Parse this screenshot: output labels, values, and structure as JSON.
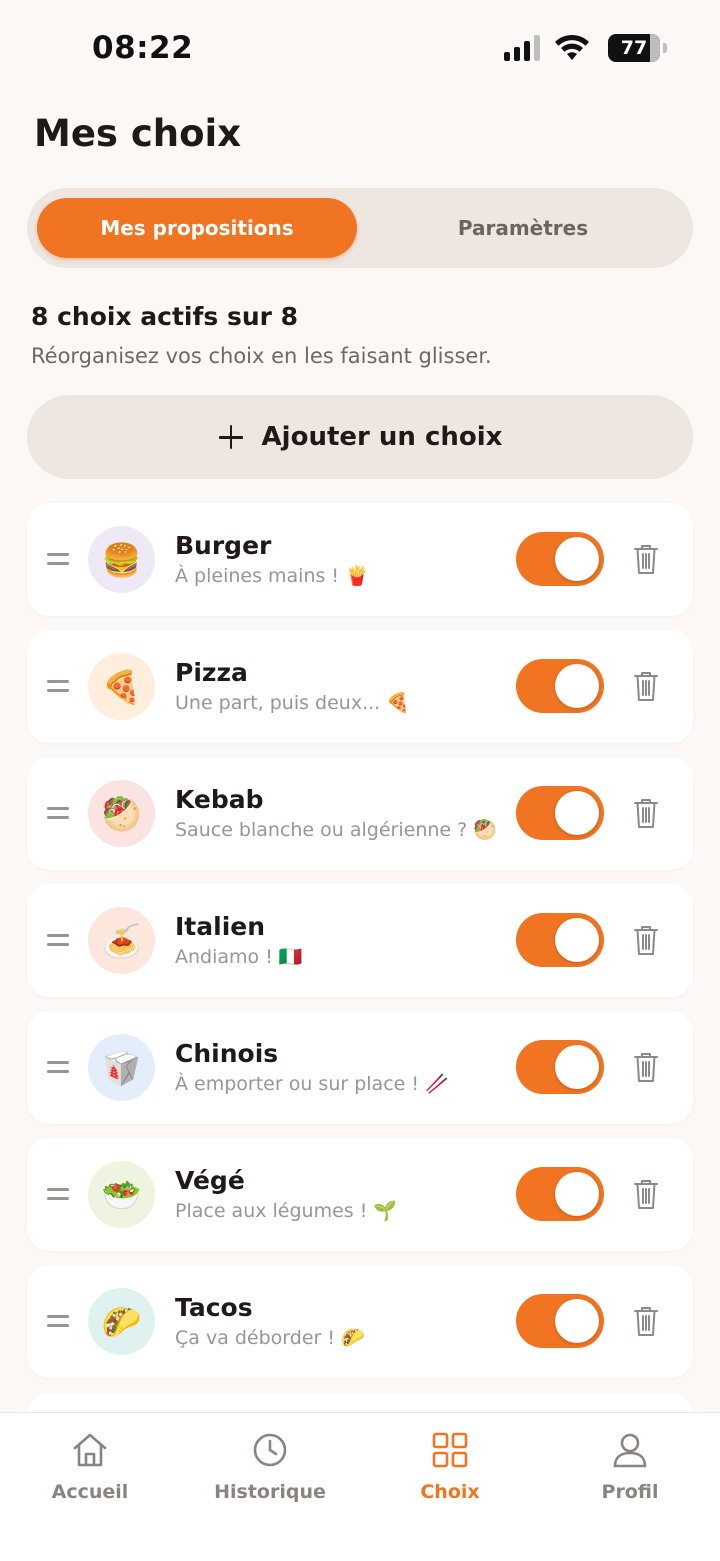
{
  "status_bar": {
    "time": "08:22",
    "battery": "77"
  },
  "page_title": "Mes choix",
  "tabs_top": {
    "active": "Mes propositions",
    "inactive": "Paramètres"
  },
  "summary": {
    "title": "8 choix actifs sur 8",
    "subtitle": "Réorganisez vos choix en les faisant glisser."
  },
  "add_button": {
    "label": "Ajouter un choix"
  },
  "colors": {
    "accent": "#f07421",
    "background": "#fcf8f5",
    "segment_bg": "#ede6e1"
  },
  "choices": [
    {
      "title": "Burger",
      "subtitle": "À pleines mains ! 🍟",
      "emoji": "🍔",
      "enabled": true,
      "avatar_bg": "#efe9f7"
    },
    {
      "title": "Pizza",
      "subtitle": "Une part, puis deux... 🍕",
      "emoji": "🍕",
      "enabled": true,
      "avatar_bg": "#fdeedd"
    },
    {
      "title": "Kebab",
      "subtitle": "Sauce blanche ou algérienne ? 🥙",
      "emoji": "🥙",
      "enabled": true,
      "avatar_bg": "#fbe3e1"
    },
    {
      "title": "Italien",
      "subtitle": "Andiamo ! 🇮🇹",
      "emoji": "🍝",
      "enabled": true,
      "avatar_bg": "#fde6dc"
    },
    {
      "title": "Chinois",
      "subtitle": "À emporter ou sur place ! 🥢",
      "emoji": "🥡",
      "enabled": true,
      "avatar_bg": "#e3eefa"
    },
    {
      "title": "Végé",
      "subtitle": "Place aux légumes ! 🌱",
      "emoji": "🥗",
      "enabled": true,
      "avatar_bg": "#eef4e0"
    },
    {
      "title": "Tacos",
      "subtitle": "Ça va déborder ! 🌮",
      "emoji": "🌮",
      "enabled": true,
      "avatar_bg": "#dff2ef"
    }
  ],
  "bottom_nav": [
    {
      "label": "Accueil",
      "icon": "home-icon",
      "active": false
    },
    {
      "label": "Historique",
      "icon": "clock-icon",
      "active": false
    },
    {
      "label": "Choix",
      "icon": "grid-icon",
      "active": true
    },
    {
      "label": "Profil",
      "icon": "user-icon",
      "active": false
    }
  ]
}
